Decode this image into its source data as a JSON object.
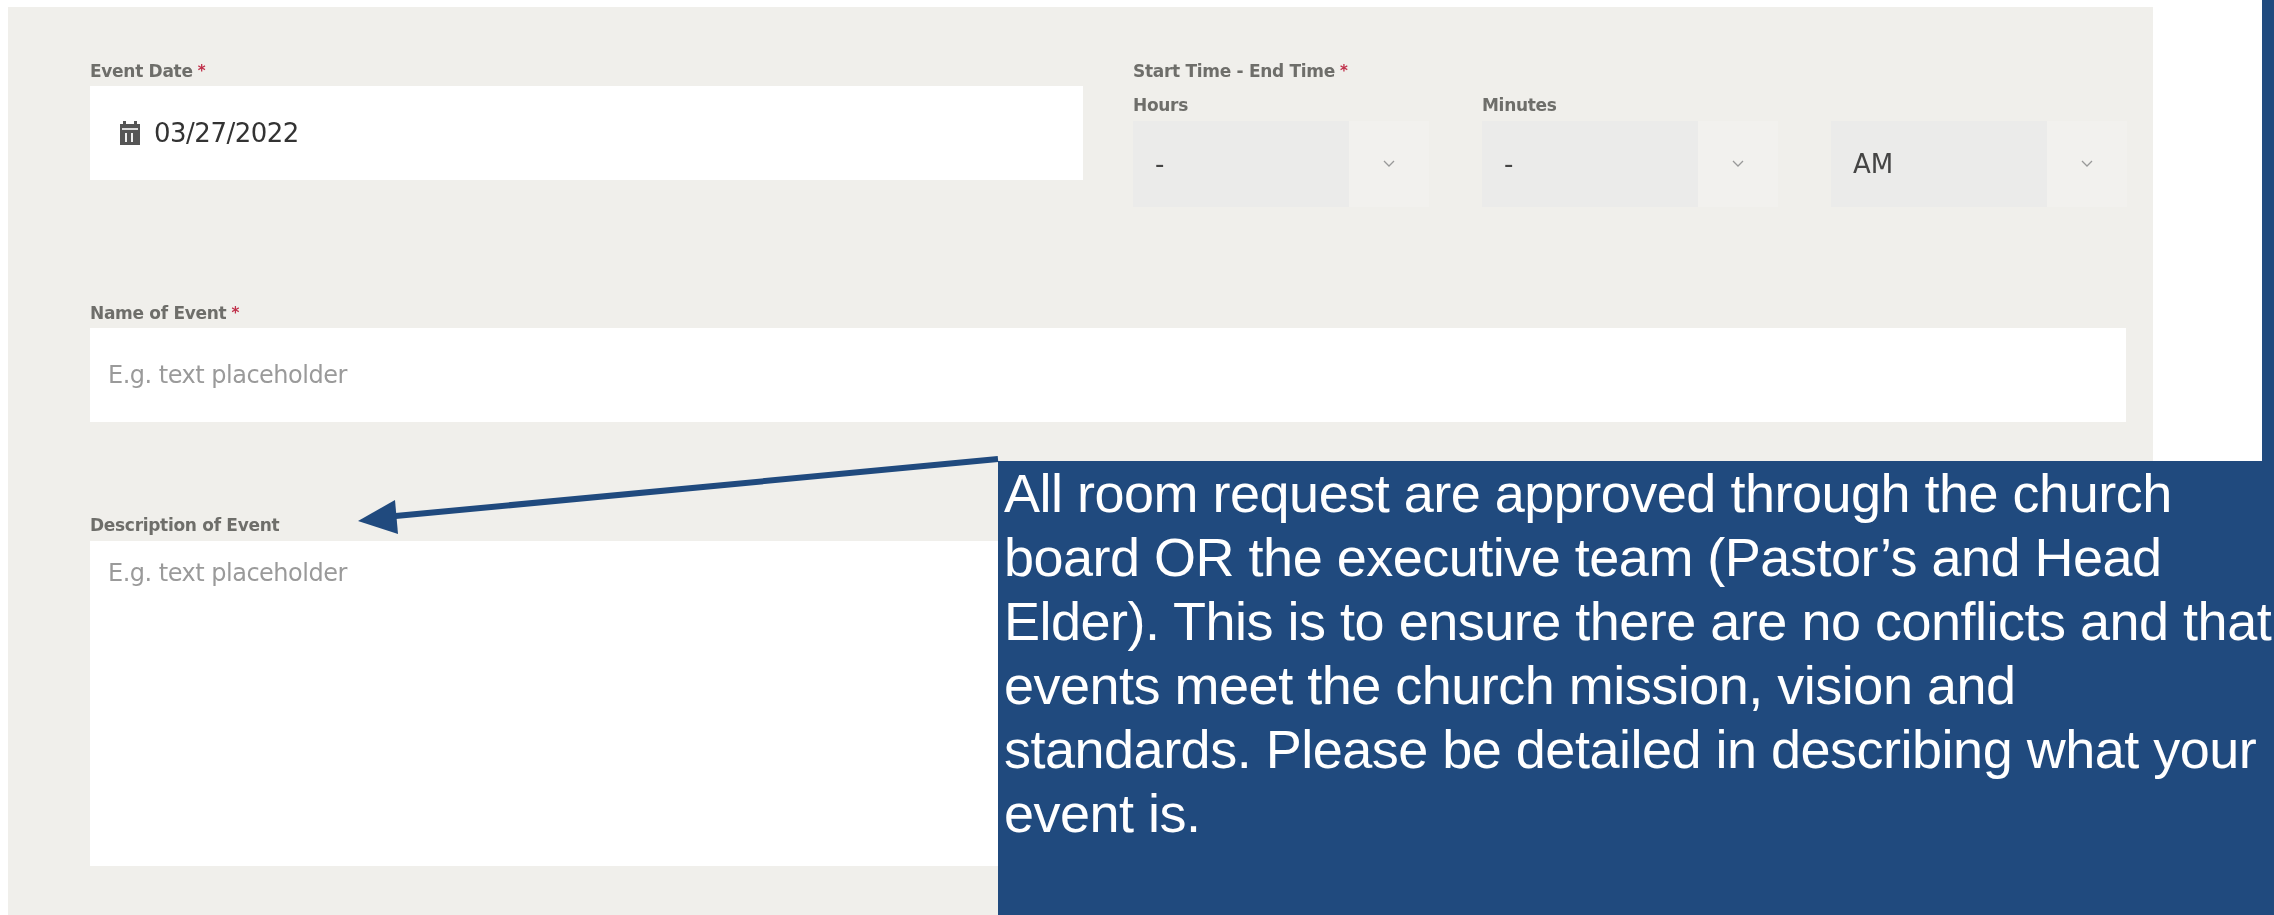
{
  "form": {
    "event_date": {
      "label": "Event Date",
      "required_mark": "*",
      "value": "03/27/2022"
    },
    "time": {
      "label": "Start Time - End Time",
      "required_mark": "*",
      "selects": [
        {
          "label": "Hours",
          "value": "-"
        },
        {
          "label": "Minutes",
          "value": "-"
        },
        {
          "value": "AM"
        }
      ]
    },
    "name_of_event": {
      "label": "Name of Event",
      "required_mark": "*",
      "placeholder": "E.g. text placeholder"
    },
    "description": {
      "label": "Description of Event",
      "placeholder": "E.g. text placeholder"
    }
  },
  "callout": {
    "text": "All room request are approved through the church board OR the executive team (Pastor’s and Head Elder). This is to ensure there are no conflicts and that events meet the church mission, vision and standards. Please be detailed in describing what your event is."
  }
}
